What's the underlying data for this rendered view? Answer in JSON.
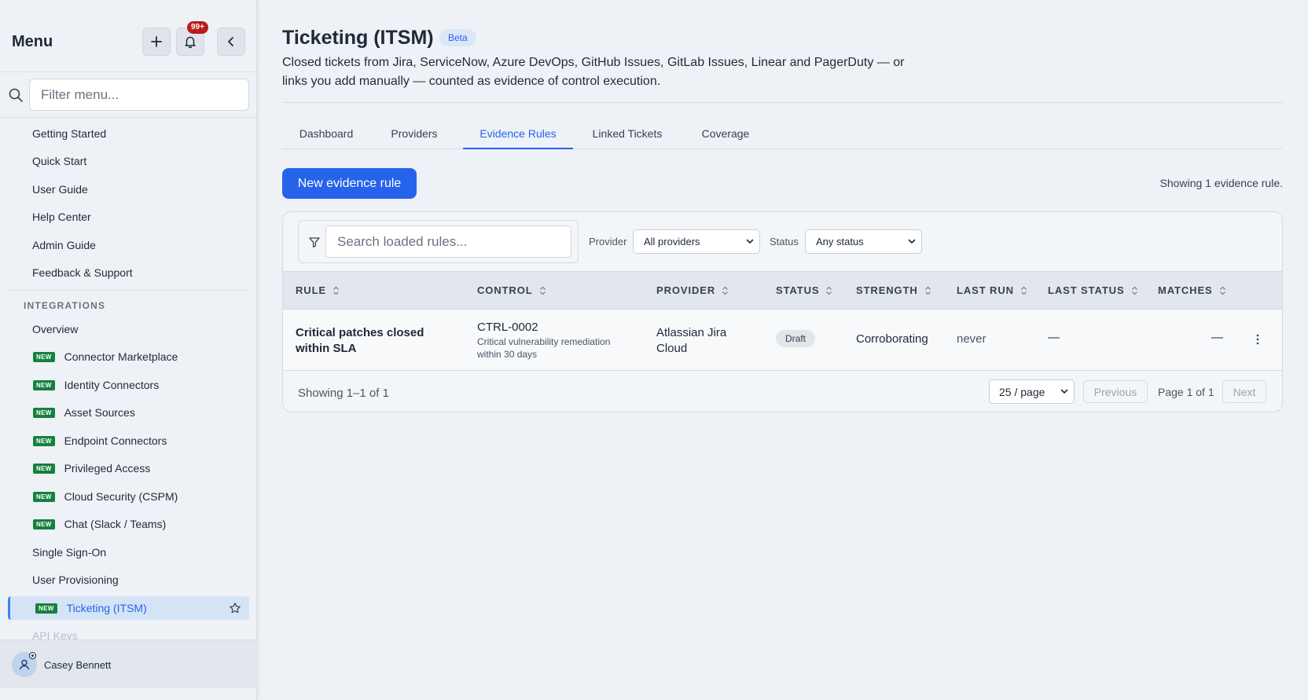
{
  "sidebar": {
    "title": "Menu",
    "notification_count": "99+",
    "filter_placeholder": "Filter menu...",
    "items_top": [
      {
        "label": "Getting Started"
      },
      {
        "label": "Quick Start"
      },
      {
        "label": "User Guide"
      },
      {
        "label": "Help Center"
      },
      {
        "label": "Admin Guide"
      },
      {
        "label": "Feedback & Support"
      }
    ],
    "section_label": "INTEGRATIONS",
    "new_tag": "NEW",
    "integrations": [
      {
        "label": "Overview",
        "is_new": false
      },
      {
        "label": "Connector Marketplace",
        "is_new": true
      },
      {
        "label": "Identity Connectors",
        "is_new": true
      },
      {
        "label": "Asset Sources",
        "is_new": true
      },
      {
        "label": "Endpoint Connectors",
        "is_new": true
      },
      {
        "label": "Privileged Access",
        "is_new": true
      },
      {
        "label": "Cloud Security (CSPM)",
        "is_new": true
      },
      {
        "label": "Chat (Slack / Teams)",
        "is_new": true
      },
      {
        "label": "Single Sign-On",
        "is_new": false
      },
      {
        "label": "User Provisioning",
        "is_new": false
      },
      {
        "label": "Ticketing (ITSM)",
        "is_new": true,
        "active": true
      },
      {
        "label": "API Keys",
        "is_new": false
      }
    ],
    "user_name": "Casey Bennett"
  },
  "page": {
    "title": "Ticketing (ITSM)",
    "badge": "Beta",
    "subtitle": "Closed tickets from Jira, ServiceNow, Azure DevOps, GitHub Issues, GitLab Issues, Linear and PagerDuty — or links you add manually — counted as evidence of control execution."
  },
  "tabs": [
    {
      "label": "Dashboard"
    },
    {
      "label": "Providers"
    },
    {
      "label": "Evidence Rules",
      "active": true
    },
    {
      "label": "Linked Tickets"
    },
    {
      "label": "Coverage"
    }
  ],
  "toolbar": {
    "new_rule_label": "New evidence rule",
    "showing_count": "Showing 1 evidence rule."
  },
  "filters": {
    "search_placeholder": "Search loaded rules...",
    "provider_label": "Provider",
    "provider_value": "All providers",
    "status_label": "Status",
    "status_value": "Any status"
  },
  "table": {
    "columns": [
      "RULE",
      "CONTROL",
      "PROVIDER",
      "STATUS",
      "STRENGTH",
      "LAST RUN",
      "LAST STATUS",
      "MATCHES"
    ],
    "rows": [
      {
        "rule": "Critical patches closed within SLA",
        "control_id": "CTRL-0002",
        "control_desc": "Critical vulnerability remediation within 30 days",
        "provider": "Atlassian Jira Cloud",
        "status": "Draft",
        "strength": "Corroborating",
        "last_run": "never",
        "last_status": "—",
        "matches": "—"
      }
    ]
  },
  "pagination": {
    "showing": "Showing 1–1 of 1",
    "per_page": "25 / page",
    "previous": "Previous",
    "page_text": "Page 1 of 1",
    "next": "Next"
  },
  "colors": {
    "accent": "#2563eb",
    "new_tag": "#15803d",
    "notification": "#b91c1c"
  }
}
